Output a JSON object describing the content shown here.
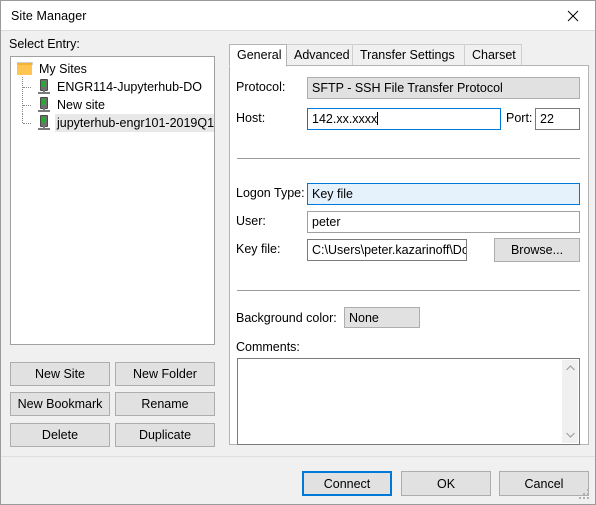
{
  "window": {
    "title": "Site Manager",
    "close_icon": "close-icon"
  },
  "left": {
    "select_entry_label": "Select Entry:",
    "tree": [
      {
        "label": "My Sites",
        "icon": "folder-icon",
        "type": "folder",
        "selected": false
      },
      {
        "label": "ENGR114-Jupyterhub-DO",
        "icon": "server-icon",
        "type": "site",
        "selected": false
      },
      {
        "label": "New site",
        "icon": "server-icon",
        "type": "site",
        "selected": false
      },
      {
        "label": "jupyterhub-engr101-2019Q1",
        "icon": "server-icon",
        "type": "site",
        "selected": true
      }
    ],
    "buttons": {
      "new_site": "New Site",
      "new_folder": "New Folder",
      "new_bookmark": "New Bookmark",
      "rename": "Rename",
      "delete": "Delete",
      "duplicate": "Duplicate"
    }
  },
  "right": {
    "tabs": [
      {
        "label": "General",
        "active": true
      },
      {
        "label": "Advanced",
        "active": false
      },
      {
        "label": "Transfer Settings",
        "active": false
      },
      {
        "label": "Charset",
        "active": false
      }
    ],
    "general": {
      "protocol_label": "Protocol:",
      "protocol_value": "SFTP - SSH File Transfer Protocol",
      "host_label": "Host:",
      "host_value": "142.xx.xxxx",
      "port_label": "Port:",
      "port_value": "22",
      "logon_type_label": "Logon Type:",
      "logon_type_value": "Key file",
      "user_label": "User:",
      "user_value": "peter",
      "key_file_label": "Key file:",
      "key_file_value": "C:\\Users\\peter.kazarinoff\\Docur",
      "browse_label": "Browse...",
      "background_color_label": "Background color:",
      "background_color_value": "None",
      "comments_label": "Comments:",
      "comments_value": ""
    }
  },
  "footer": {
    "connect": "Connect",
    "ok": "OK",
    "cancel": "Cancel"
  },
  "colors": {
    "accent": "#0078d7",
    "button_face": "#e1e1e1",
    "dialog_face": "#f0f0f0",
    "selection": "#e8e8e8",
    "combo_blue_bg": "#e5f1fb"
  }
}
